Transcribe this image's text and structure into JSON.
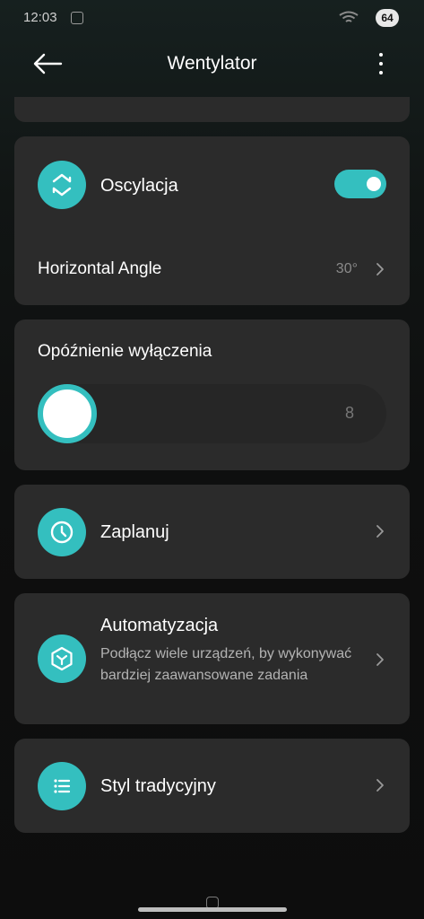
{
  "status_bar": {
    "time": "12:03",
    "battery": "64"
  },
  "app_bar": {
    "title": "Wentylator"
  },
  "oscillation": {
    "label": "Oscylacja",
    "enabled": true
  },
  "horizontal_angle": {
    "label": "Horizontal Angle",
    "value": "30°"
  },
  "shutdown_delay": {
    "label": "Opóźnienie wyłączenia",
    "value": "8"
  },
  "schedule": {
    "label": "Zaplanuj"
  },
  "automation": {
    "label": "Automatyzacja",
    "description": "Podłącz wiele urządzeń, by wykonywać bardziej zaawansowane zadania"
  },
  "classic_style": {
    "label": "Styl tradycyjny"
  },
  "colors": {
    "accent": "#34bfbf",
    "card": "#2b2b2b",
    "background": "#0d0d0d"
  }
}
